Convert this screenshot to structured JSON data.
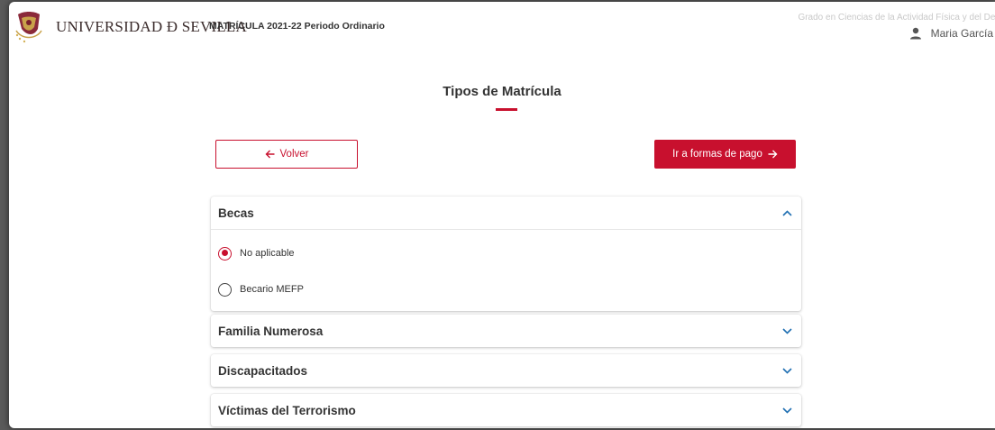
{
  "header": {
    "university_name": "UNIVERSIDAD Ð SEVILLA",
    "period": "MATRÍCULA 2021-22 Periodo Ordinario",
    "degree": "Grado en Ciencias de la Actividad Física y del Dep",
    "user_name": "Maria García",
    "logo_icon": "university-seal-icon",
    "user_icon": "user-icon"
  },
  "page": {
    "title": "Tipos de Matrícula"
  },
  "actions": {
    "back_label": "Volver",
    "back_icon": "arrow-left-icon",
    "next_label": "Ir a formas de pago",
    "next_icon": "arrow-right-icon"
  },
  "sections": [
    {
      "title": "Becas",
      "expanded": true,
      "options": [
        {
          "label": "No aplicable",
          "selected": true
        },
        {
          "label": "Becario MEFP",
          "selected": false
        }
      ]
    },
    {
      "title": "Familia Numerosa",
      "expanded": false
    },
    {
      "title": "Discapacitados",
      "expanded": false
    },
    {
      "title": "Víctimas del Terrorismo",
      "expanded": false
    }
  ],
  "colors": {
    "accent": "#c8102e",
    "chevron": "#1f6fb2",
    "text": "#333333"
  }
}
